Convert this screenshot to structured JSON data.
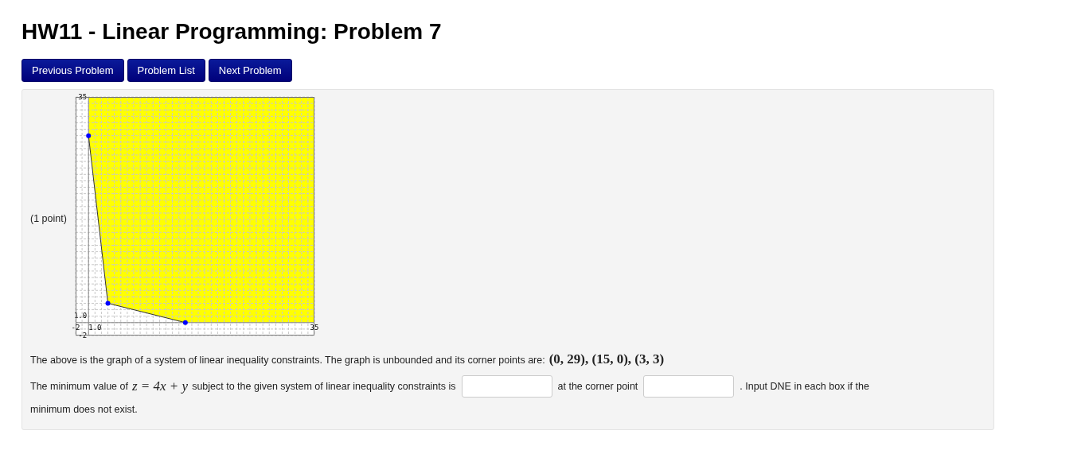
{
  "title": "HW11 - Linear Programming: Problem 7",
  "nav_buttons": [
    "Previous Problem",
    "Problem List",
    "Next Problem"
  ],
  "problem": {
    "points": "(1 point)",
    "graph": {
      "chart_data": {
        "type": "line",
        "grid": true,
        "xlim": [
          -2,
          35
        ],
        "ylim": [
          -2,
          35
        ],
        "xticks": [
          {
            "value": -2,
            "label": "-2"
          },
          {
            "value": 1,
            "label": "1.0"
          },
          {
            "value": 35,
            "label": "35"
          }
        ],
        "yticks": [
          {
            "value": -2,
            "label": "-2"
          },
          {
            "value": 1,
            "label": "1.0"
          },
          {
            "value": 35,
            "label": "35"
          }
        ],
        "series": [
          {
            "marker": "circle",
            "color": "#0000ff",
            "x": [
              0,
              3,
              15
            ],
            "values": [
              29,
              3,
              0
            ]
          }
        ]
      }
    },
    "statement": "The above is the graph of a system of linear inequality constraints. The graph is unbounded and its corner points are:",
    "corner_points": "(0, 29), (15, 0), (3, 3)",
    "question_start": "The minimum value of",
    "objective": "z = 4x + y",
    "question_mid": "subject to the given system of linear inequality constraints is",
    "question_mid2": "at the corner point",
    "question_end": ". Input DNE in each box if the",
    "question_end2": "minimum does not exist."
  }
}
